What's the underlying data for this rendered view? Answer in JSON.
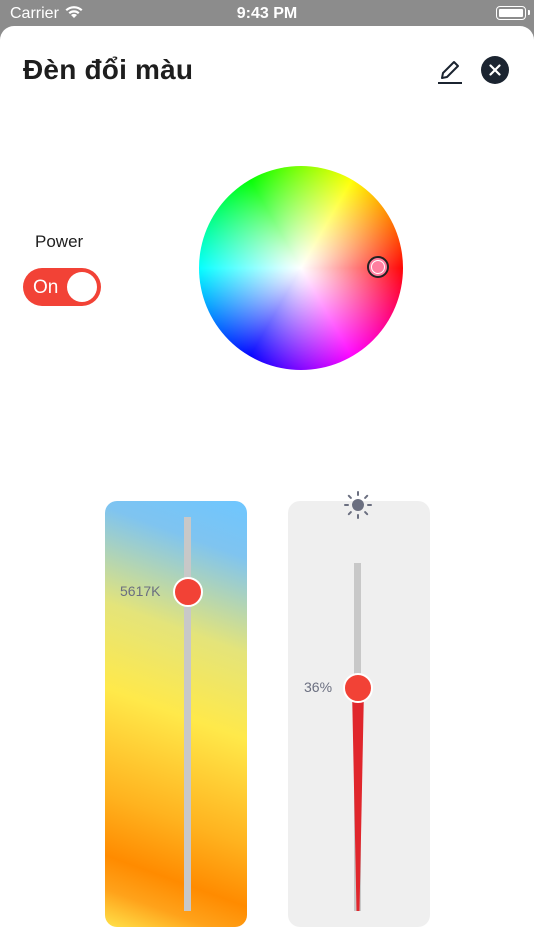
{
  "status_bar": {
    "carrier": "Carrier",
    "time": "9:43 PM",
    "wifi_icon": "wifi-icon",
    "battery_icon": "battery-icon"
  },
  "header": {
    "title": "Đèn đổi màu",
    "edit_icon": "edit-pencil-icon",
    "close_icon": "close-icon"
  },
  "power": {
    "label": "Power",
    "state": "On",
    "on": true
  },
  "color_wheel": {
    "selected_color": "#ff7fa0",
    "hue_deg": 350,
    "saturation": 0.6
  },
  "temperature": {
    "value_label": "5617K",
    "level": 0.19
  },
  "brightness": {
    "icon": "sun-icon",
    "value_label": "36%",
    "level": 0.36
  },
  "colors": {
    "accent": "#f24236",
    "close_bg": "#1b2430",
    "track": "#c8c8c8",
    "brightness_panel": "#efefef"
  }
}
